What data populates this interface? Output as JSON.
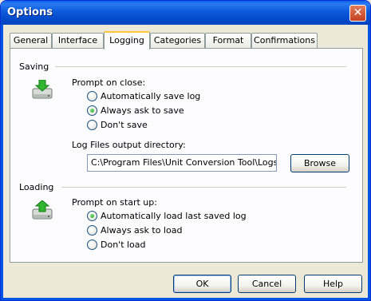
{
  "window": {
    "title": "Options",
    "close_glyph": "✕"
  },
  "tabs": [
    {
      "label": "General"
    },
    {
      "label": "Interface"
    },
    {
      "label": "Logging"
    },
    {
      "label": "Categories"
    },
    {
      "label": "Format"
    },
    {
      "label": "Confirmations"
    }
  ],
  "active_tab": "Logging",
  "saving": {
    "section_label": "Saving",
    "icon": "disk-save-icon",
    "prompt_label": "Prompt on close:",
    "options": [
      {
        "label": "Automatically save log",
        "checked": false
      },
      {
        "label": "Always ask to save",
        "checked": true
      },
      {
        "label": "Don't save",
        "checked": false
      }
    ],
    "directory_label": "Log Files output directory:",
    "directory_value": "C:\\Program Files\\Unit Conversion Tool\\Logs",
    "browse_label": "Browse"
  },
  "loading": {
    "section_label": "Loading",
    "icon": "disk-load-icon",
    "prompt_label": "Prompt on start up:",
    "options": [
      {
        "label": "Automatically load last saved log",
        "checked": true
      },
      {
        "label": "Always ask to load",
        "checked": false
      },
      {
        "label": "Don't load",
        "checked": false
      }
    ]
  },
  "footer": {
    "ok_label": "OK",
    "cancel_label": "Cancel",
    "help_label": "Help"
  },
  "colors": {
    "titlebar": "#0054e3",
    "active_tab_accent": "#ffc83c",
    "panel": "#fcfcfe",
    "dialog": "#ece9d8"
  }
}
